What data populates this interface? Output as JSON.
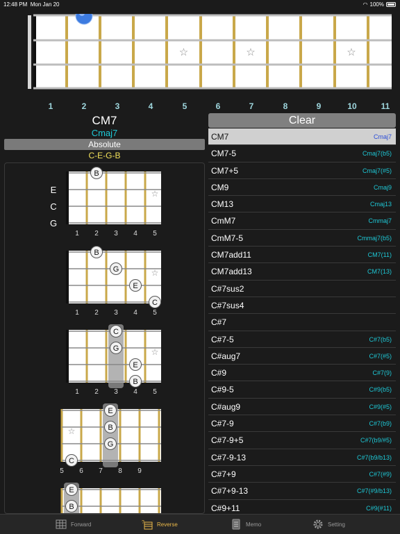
{
  "status_bar": {
    "time": "12:48 PM",
    "date": "Mon Jan 20",
    "battery": "100%"
  },
  "neck": {
    "fret_numbers": [
      "1",
      "2",
      "3",
      "4",
      "5",
      "6",
      "7",
      "8",
      "9",
      "10",
      "11"
    ],
    "position_marker": "blue-dot",
    "inlay_symbol": "☆"
  },
  "chord_info": {
    "name": "CM7",
    "alias": "Cmaj7",
    "mode_button": "Absolute",
    "notes": "C-E-G-B"
  },
  "string_labels": [
    "E",
    "C",
    "G"
  ],
  "diagrams": [
    {
      "fret_labels": [
        "1",
        "2",
        "3",
        "4",
        "5"
      ],
      "notes": [
        {
          "s": 0,
          "f": 2,
          "n": "B"
        }
      ],
      "stars": [
        {
          "s": 1,
          "f": 5
        }
      ],
      "highlight": null,
      "nut": true,
      "show_strings": true
    },
    {
      "fret_labels": [
        "1",
        "2",
        "3",
        "4",
        "5"
      ],
      "notes": [
        {
          "s": 0,
          "f": 2,
          "n": "B"
        },
        {
          "s": 1,
          "f": 3,
          "n": "G"
        },
        {
          "s": 2,
          "f": 4,
          "n": "E"
        },
        {
          "s": 3,
          "f": 5,
          "n": "C"
        }
      ],
      "stars": [
        {
          "s": 1,
          "f": 5
        }
      ],
      "highlight": null,
      "nut": true,
      "show_strings": false
    },
    {
      "fret_labels": [
        "1",
        "2",
        "3",
        "4",
        "5"
      ],
      "notes": [
        {
          "s": 0,
          "f": 3,
          "n": "C"
        },
        {
          "s": 1,
          "f": 3,
          "n": "G"
        },
        {
          "s": 2,
          "f": 4,
          "n": "E"
        },
        {
          "s": 3,
          "f": 4,
          "n": "B"
        }
      ],
      "stars": [
        {
          "s": 1,
          "f": 5
        }
      ],
      "highlight": 3,
      "nut": true,
      "show_strings": false
    },
    {
      "fret_labels": [
        "5",
        "6",
        "7",
        "8",
        "9"
      ],
      "notes": [
        {
          "s": 0,
          "f": 3,
          "n": "E"
        },
        {
          "s": 1,
          "f": 3,
          "n": "B"
        },
        {
          "s": 2,
          "f": 3,
          "n": "G"
        },
        {
          "s": 3,
          "f": 1,
          "n": "C"
        }
      ],
      "stars": [
        {
          "s": 1,
          "f": 1
        }
      ],
      "highlight": 3,
      "nut": false,
      "show_strings": false
    },
    {
      "fret_labels": [],
      "notes": [
        {
          "s": 0,
          "f": 1,
          "n": "E"
        },
        {
          "s": 1,
          "f": 1,
          "n": "B"
        }
      ],
      "stars": [],
      "highlight": 1,
      "nut": false,
      "show_strings": false
    }
  ],
  "clear_button": "Clear",
  "chords": [
    {
      "name": "CM7",
      "alias": "Cmaj7",
      "selected": true
    },
    {
      "name": "CM7-5",
      "alias": "Cmaj7(b5)"
    },
    {
      "name": "CM7+5",
      "alias": "Cmaj7(#5)"
    },
    {
      "name": "CM9",
      "alias": "Cmaj9"
    },
    {
      "name": "CM13",
      "alias": "Cmaj13"
    },
    {
      "name": "CmM7",
      "alias": "Cmmaj7"
    },
    {
      "name": "CmM7-5",
      "alias": "Cmmaj7(b5)"
    },
    {
      "name": "CM7add11",
      "alias": "CM7(11)"
    },
    {
      "name": "CM7add13",
      "alias": "CM7(13)"
    },
    {
      "name": "C#7sus2",
      "alias": ""
    },
    {
      "name": "C#7sus4",
      "alias": ""
    },
    {
      "name": "C#7",
      "alias": ""
    },
    {
      "name": "C#7-5",
      "alias": "C#7(b5)"
    },
    {
      "name": "C#aug7",
      "alias": "C#7(#5)"
    },
    {
      "name": "C#9",
      "alias": "C#7(9)"
    },
    {
      "name": "C#9-5",
      "alias": "C#9(b5)"
    },
    {
      "name": "C#aug9",
      "alias": "C#9(#5)"
    },
    {
      "name": "C#7-9",
      "alias": "C#7(b9)"
    },
    {
      "name": "C#7-9+5",
      "alias": "C#7(b9/#5)"
    },
    {
      "name": "C#7-9-13",
      "alias": "C#7(b9/b13)"
    },
    {
      "name": "C#7+9",
      "alias": "C#7(#9)"
    },
    {
      "name": "C#7+9-13",
      "alias": "C#7(#9/b13)"
    },
    {
      "name": "C#9+11",
      "alias": "C#9(#11)"
    }
  ],
  "tabs": [
    {
      "label": "Forward",
      "icon": "grid-icon",
      "active": false
    },
    {
      "label": "Reverse",
      "icon": "chord-reverse-icon",
      "active": true
    },
    {
      "label": "Memo",
      "icon": "memo-icon",
      "active": false
    },
    {
      "label": "Setting",
      "icon": "gear-icon",
      "active": false
    }
  ],
  "colors": {
    "accent": "#1ec8d6",
    "notes_yellow": "#f2e05a",
    "fret_gold": "#c9a84a",
    "active_tab": "#e9b84a"
  }
}
